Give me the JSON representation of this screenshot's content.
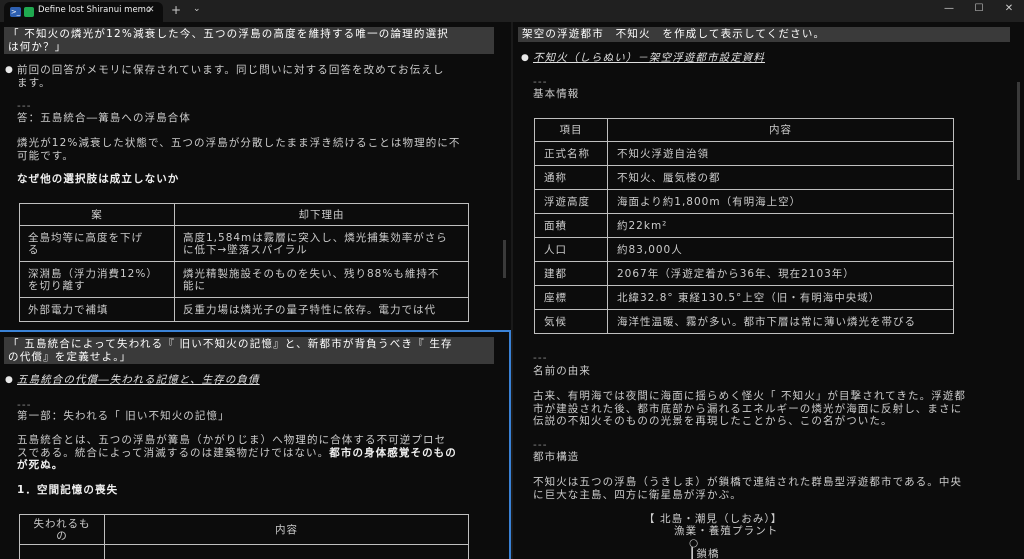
{
  "window": {
    "tab_title": "Define lost Shiranui memo",
    "tab_close": "✕",
    "new_tab": "+",
    "tab_dropdown": "⌄",
    "minimize": "—",
    "maximize": "☐",
    "close": "✕"
  },
  "left_top": {
    "prompt_lines": [
      "「 不知火の燐光が12%減衰した今、五つの浮島の高度を維持する唯一の論理的選択",
      "は何か？」"
    ],
    "intro_lines": [
      "前回の回答がメモリに保存されています。同じ問いに対する回答を改めてお伝えし",
      "ます。"
    ],
    "rule": "---",
    "answer": "答：五島統合―篝島への浮島合体",
    "para_lines": [
      "燐光が12%減衰した状態で、五つの浮島が分散したまま浮き続けることは物理的に不",
      "可能です。"
    ],
    "heading": "なぜ他の選択肢は成立しないか",
    "table": {
      "headers": [
        "案",
        "却下理由"
      ],
      "rows": [
        [
          [
            "全島均等に高度を下げ",
            "る"
          ],
          [
            "高度1,584mは霧層に突入し、燐光捕集効率がさら",
            "に低下→墜落スパイラル"
          ]
        ],
        [
          [
            "深淵島（浮力消費12%）",
            "を切り離す"
          ],
          [
            "燐光精製施設そのものを失い、残り88%も維持不",
            "能に"
          ]
        ],
        [
          [
            "外部電力で補填"
          ],
          [
            "反重力場は燐光子の量子特性に依存。電力では代"
          ]
        ]
      ]
    }
  },
  "left_bottom": {
    "prompt_lines": [
      "「 五島統合によって失われる『 旧い不知火の記憶』と、新都市が背負うべき『 生存",
      "の代償』を定義せよ。」"
    ],
    "title": "五島統合の代償―失われる記憶と、生存の負債",
    "rule": "---",
    "part": "第一部：失われる「 旧い不知火の記憶」",
    "para_lines": [
      "五島統合とは、五つの浮島が篝島（かがりじま）へ物理的に合体する不可逆プロセ",
      "スである。統合によって消滅するのは建築物だけではない。"
    ],
    "para_bold_lines": [
      "都市の身体感覚そのもの",
      "が死ぬ。"
    ],
    "sub": "1．空間記憶の喪失",
    "table": {
      "headers": [
        [
          "失われるも",
          "の"
        ],
        [
          "内容"
        ]
      ]
    }
  },
  "right": {
    "prompt": "架空の浮遊都市　不知火　を作成して表示してください。",
    "title": "不知火（しらぬい）－架空浮遊都市設定資料",
    "rule1": "---",
    "section1": "基本情報",
    "table": {
      "headers": [
        "項目",
        "内容"
      ],
      "rows": [
        [
          "正式名称",
          "不知火浮遊自治領"
        ],
        [
          "通称",
          "不知火、蜃気楼の都"
        ],
        [
          "浮遊高度",
          "海面より約1,800m（有明海上空）"
        ],
        [
          "面積",
          "約22km²"
        ],
        [
          "人口",
          "約83,000人"
        ],
        [
          "建都",
          "2067年（浮遊定着から36年、現在2103年）"
        ],
        [
          "座標",
          "北緯32.8° 東経130.5°上空（旧・有明海中央域）"
        ],
        [
          "気候",
          "海洋性温暖、霧が多い。都市下層は常に薄い燐光を帯びる"
        ]
      ]
    },
    "rule2": "---",
    "section2": "名前の由来",
    "origin_lines": [
      "古来、有明海では夜間に海面に揺らめく怪火「 不知火」が目撃されてきた。浮遊都",
      "市が建設された後、都市底部から漏れるエネルギーの燐光が海面に反射し、まさに",
      "伝説の不知火そのものの光景を再現したことから、この名がついた。"
    ],
    "rule3": "---",
    "section3": "都市構造",
    "structure_lines": [
      "不知火は五つの浮島（うきしま）が鎖橋で連結された群島型浮遊都市である。中央",
      "に巨大な主島、四方に衛星島が浮かぶ。"
    ],
    "diagram": {
      "node_title": "【 北島・潮見（しおみ）】",
      "node_sub": "漁業・養殖プラント",
      "circle": "○",
      "link": "┃鎖橋"
    }
  },
  "colors": {
    "background": "#0c0c0c",
    "titlebar": "#202020",
    "prompt_bg": "#3a3a3a",
    "focus_border": "#3a82d6",
    "text": "#cccccc"
  }
}
